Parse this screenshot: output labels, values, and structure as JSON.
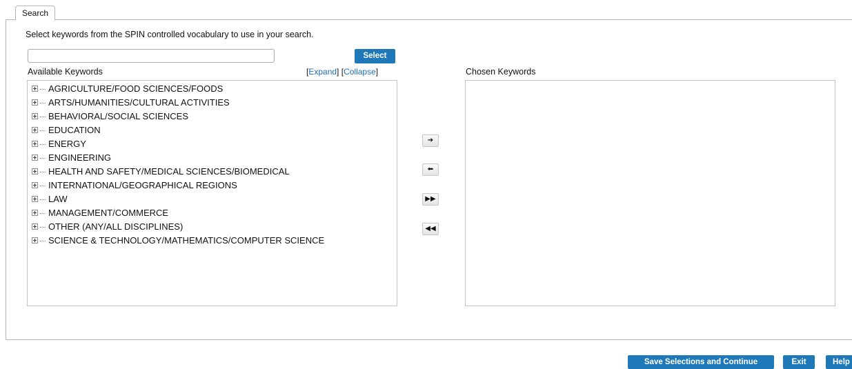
{
  "tab": {
    "label": "Search"
  },
  "instructions": "Select keywords from the SPIN controlled vocabulary to use in your search.",
  "search": {
    "value": "",
    "placeholder": ""
  },
  "select_button": "Select",
  "available": {
    "label": "Available Keywords",
    "expand": "Expand",
    "collapse": "Collapse",
    "items": [
      "AGRICULTURE/FOOD SCIENCES/FOODS",
      "ARTS/HUMANITIES/CULTURAL ACTIVITIES",
      "BEHAVIORAL/SOCIAL SCIENCES",
      "EDUCATION",
      "ENERGY",
      "ENGINEERING",
      "HEALTH AND SAFETY/MEDICAL SCIENCES/BIOMEDICAL",
      "INTERNATIONAL/GEOGRAPHICAL REGIONS",
      "LAW",
      "MANAGEMENT/COMMERCE",
      "OTHER (ANY/ALL DISCIPLINES)",
      "SCIENCE & TECHNOLOGY/MATHEMATICS/COMPUTER SCIENCE"
    ]
  },
  "chosen": {
    "label": "Chosen Keywords"
  },
  "move_buttons": {
    "add": "➔",
    "remove": "⬅",
    "add_all": "▶▶",
    "remove_all": "◀◀"
  },
  "footer": {
    "save": "Save Selections and Continue",
    "exit": "Exit",
    "help": "Help"
  },
  "colors": {
    "accent": "#1f79b9",
    "link": "#1f6fb5"
  }
}
